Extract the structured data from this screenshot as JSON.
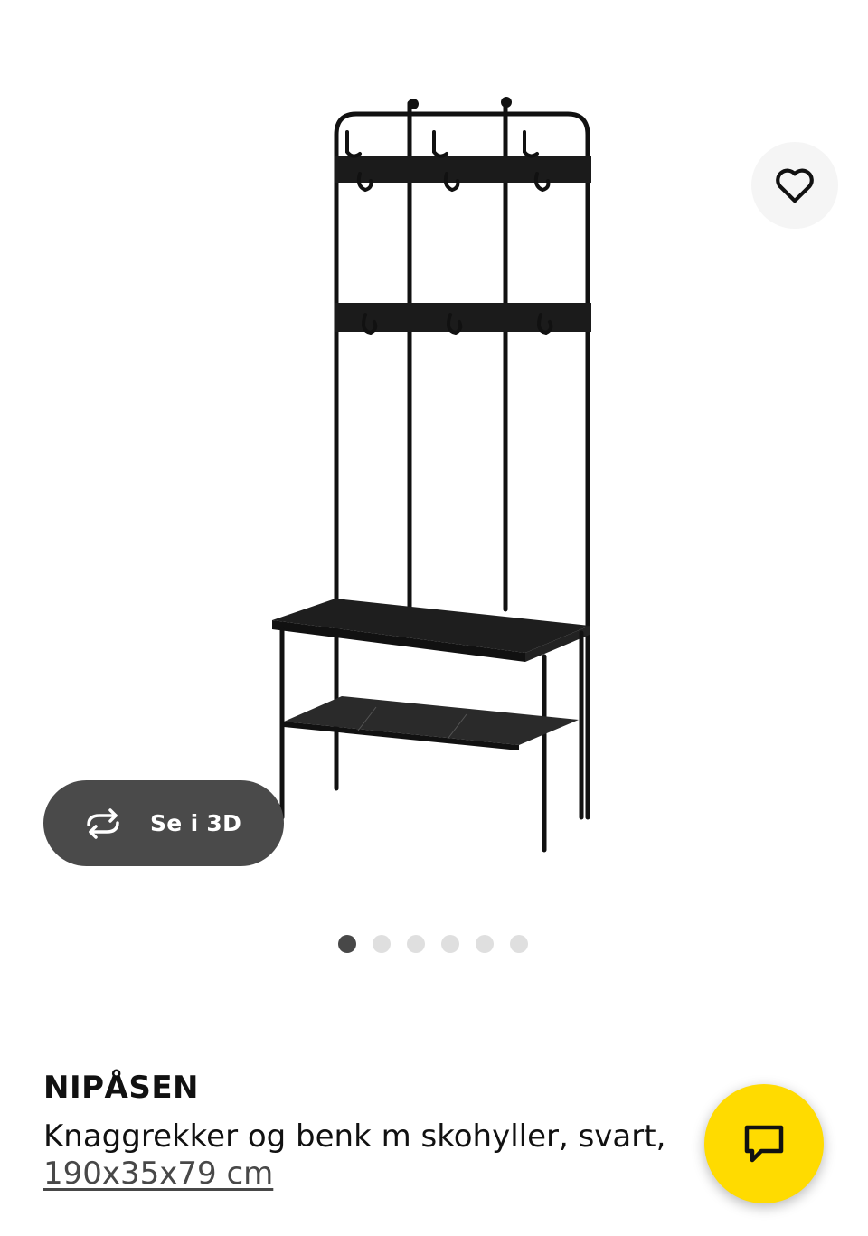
{
  "product": {
    "name": "NIPÅSEN",
    "description": "Knaggrekker og benk m skohyller, svart,",
    "dimensions": "190x35x79 cm"
  },
  "gallery": {
    "view_3d_label": "Se i 3D",
    "image_count": 6,
    "active_index": 0
  },
  "colors": {
    "accent": "#ffdb00",
    "pill": "#4a4a4a"
  }
}
